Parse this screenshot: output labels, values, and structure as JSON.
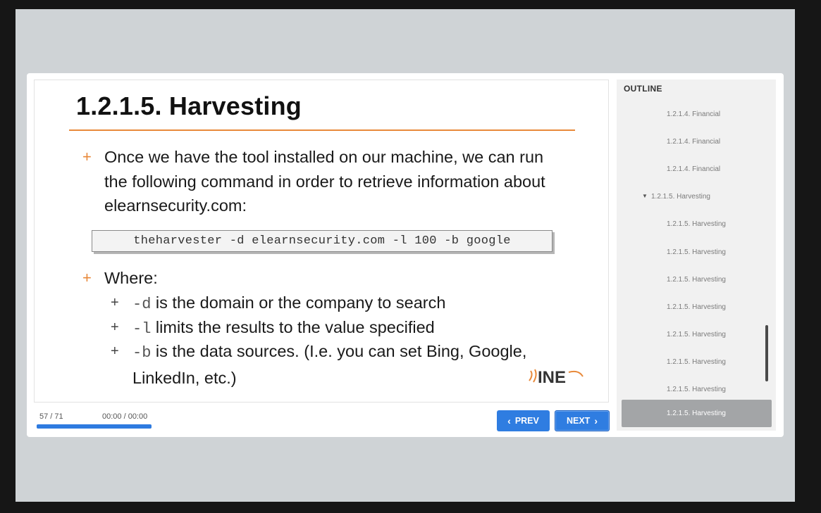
{
  "slide": {
    "title": "1.2.1.5. Harvesting",
    "bullet1": "Once we have the tool installed on our machine, we can run the following command in order to retrieve information about elearnsecurity.com:",
    "command": "theharvester -d elearnsecurity.com -l 100 -b google",
    "bullet2": "Where:",
    "sub1_code": "-d",
    "sub1_text": " is the domain or the company to search",
    "sub2_code": "-l",
    "sub2_text": " limits the results to the value specified",
    "sub3_code": "-b",
    "sub3_text": " is the data sources. (I.e. you can set Bing, Google, LinkedIn, etc.)",
    "plus": "+",
    "logo_text": "INE"
  },
  "controls": {
    "counter": "57 / 71",
    "timer": "00:00 / 00:00",
    "progress_percent": 100,
    "prev_label": "PREV",
    "next_label": "NEXT"
  },
  "outline": {
    "title": "OUTLINE",
    "items": [
      {
        "label": "1.2.1.4. Financial"
      },
      {
        "label": "1.2.1.4. Financial"
      },
      {
        "label": "1.2.1.4. Financial"
      },
      {
        "label": "1.2.1.5. Harvesting"
      },
      {
        "label": "1.2.1.5. Harvesting"
      },
      {
        "label": "1.2.1.5. Harvesting"
      },
      {
        "label": "1.2.1.5. Harvesting"
      },
      {
        "label": "1.2.1.5. Harvesting"
      },
      {
        "label": "1.2.1.5. Harvesting"
      },
      {
        "label": "1.2.1.5. Harvesting"
      },
      {
        "label": "1.2.1.5. Harvesting"
      },
      {
        "label": "1.2.1.5. Harvesting"
      }
    ]
  },
  "colors": {
    "accent_orange": "#e8893a",
    "button_blue": "#2f7de1",
    "active_item": "#a3a5a7"
  }
}
